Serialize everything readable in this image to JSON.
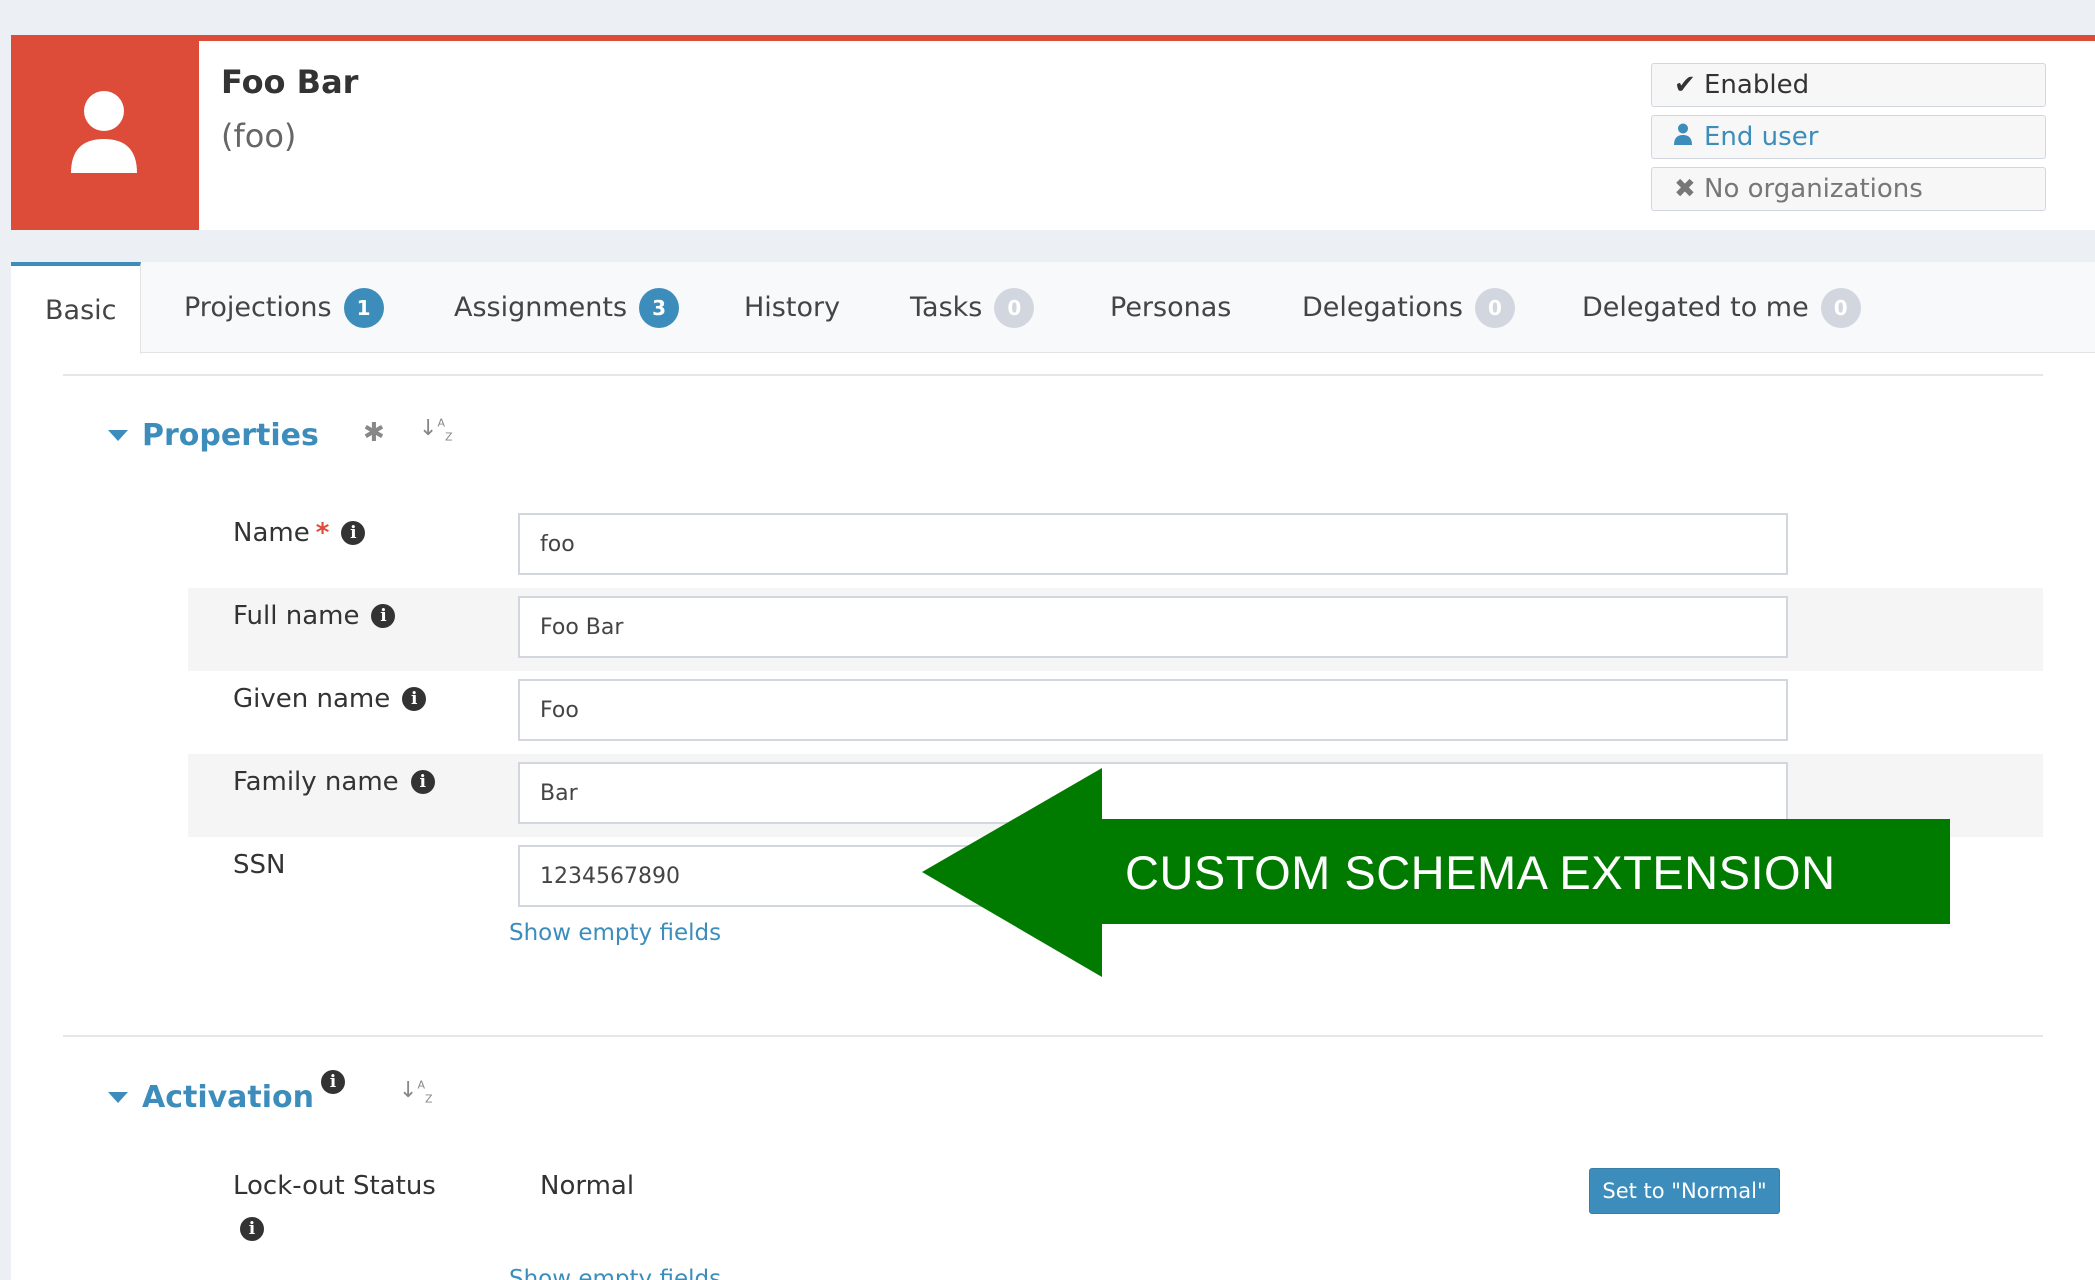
{
  "user": {
    "full_name": "Foo Bar",
    "login": "(foo)",
    "avatar_icon": "user-icon",
    "brand_color": "#dd4b39"
  },
  "status_tags": {
    "enabled": {
      "label": "Enabled",
      "icon": "check-icon"
    },
    "end_user": {
      "label": "End user",
      "icon": "user-icon"
    },
    "organizations": {
      "label": "No organizations",
      "icon": "close-icon"
    }
  },
  "tabs": [
    {
      "label": "Basic"
    },
    {
      "label": "Projections",
      "badge": "1"
    },
    {
      "label": "Assignments",
      "badge": "3"
    },
    {
      "label": "History"
    },
    {
      "label": "Tasks",
      "badge": "0"
    },
    {
      "label": "Personas"
    },
    {
      "label": "Delegations",
      "badge": "0"
    },
    {
      "label": "Delegated to me",
      "badge": "0"
    }
  ],
  "properties": {
    "title": "Properties",
    "fields": [
      {
        "label": "Name",
        "value": "foo",
        "required": true
      },
      {
        "label": "Full name",
        "value": "Foo Bar"
      },
      {
        "label": "Given name",
        "value": "Foo"
      },
      {
        "label": "Family name",
        "value": "Bar"
      },
      {
        "label": "SSN",
        "value": "1234567890"
      }
    ],
    "show_empty": "Show empty fields"
  },
  "activation": {
    "title": "Activation",
    "lockout_label": "Lock-out Status",
    "lockout_value": "Normal",
    "set_normal_label": "Set to \"Normal\"",
    "show_empty": "Show empty fields"
  },
  "annotation": {
    "text": "CUSTOM SCHEMA EXTENSION",
    "color": "#007b00"
  },
  "colors": {
    "accent": "#3c8dbc",
    "badge_inactive": "#d2d6de",
    "required": "#dd4b39"
  }
}
